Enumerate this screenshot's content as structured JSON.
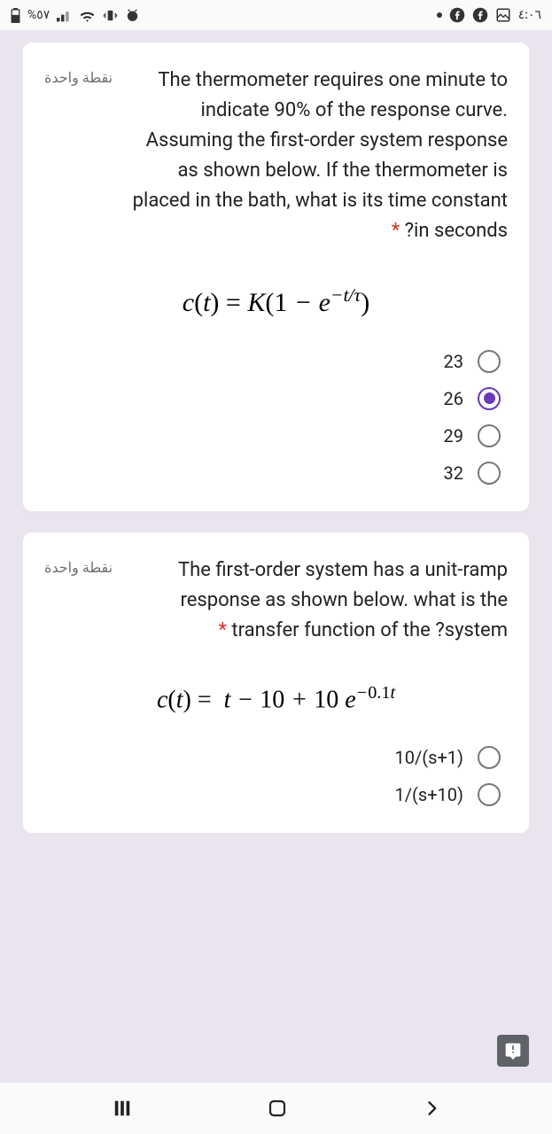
{
  "status": {
    "time": "٤:٠٦",
    "battery": "٥٧%"
  },
  "q1": {
    "points": "نقطة واحدة",
    "text_parts": {
      "a": "The thermometer requires one minute to indicate 90% of the response curve. Assuming the first-order system response as shown below. If the thermometer is placed in the bath, what is its time constant ",
      "b": "?in seconds"
    },
    "options": [
      {
        "label": "23",
        "selected": false
      },
      {
        "label": "26",
        "selected": true
      },
      {
        "label": "29",
        "selected": false
      },
      {
        "label": "32",
        "selected": false
      }
    ]
  },
  "q2": {
    "points": "نقطة واحدة",
    "text_parts": {
      "a": "The first-order system has a unit-ramp response as shown below. what is the transfer function of the ",
      "b": "?system"
    },
    "options": [
      {
        "label": "10/(s+1)",
        "selected": false
      },
      {
        "label": "1/(s+10)",
        "selected": false
      }
    ]
  }
}
